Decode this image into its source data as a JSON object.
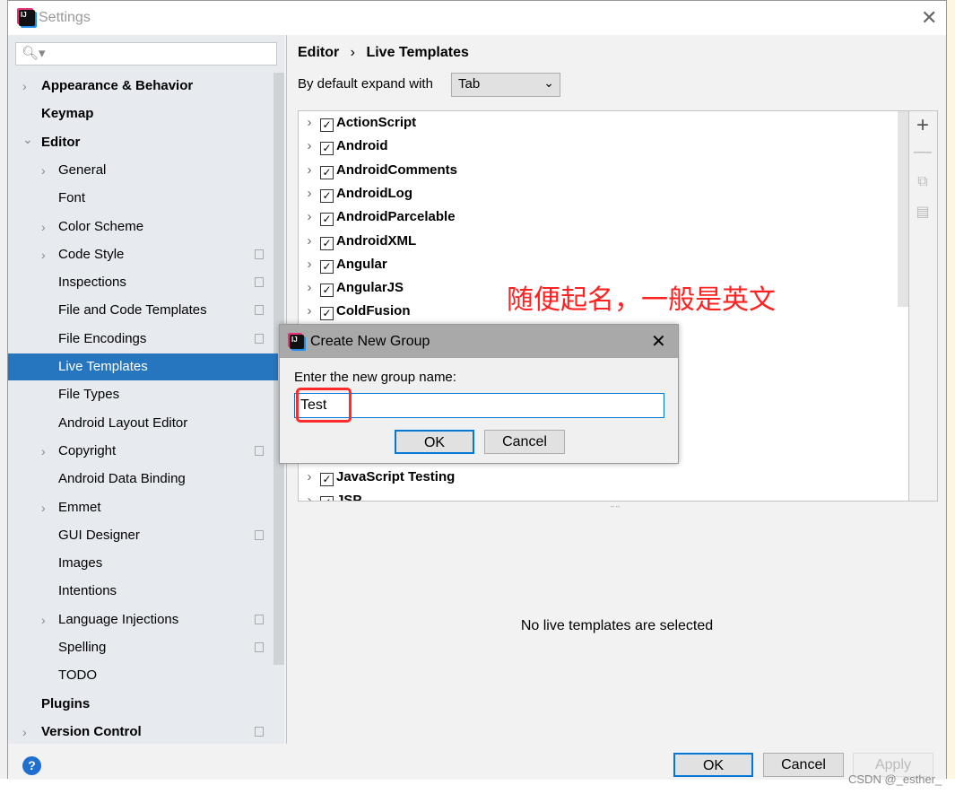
{
  "window": {
    "title": "Settings",
    "close_icon": "close-icon"
  },
  "sidebar": {
    "search_placeholder": "",
    "items": [
      {
        "label": "Appearance & Behavior",
        "level": 0,
        "bold": true,
        "expandable": true
      },
      {
        "label": "Keymap",
        "level": 0,
        "bold": true
      },
      {
        "label": "Editor",
        "level": 0,
        "bold": true,
        "expanded": true
      },
      {
        "label": "General",
        "level": 1,
        "expandable": true
      },
      {
        "label": "Font",
        "level": 1
      },
      {
        "label": "Color Scheme",
        "level": 1,
        "expandable": true
      },
      {
        "label": "Code Style",
        "level": 1,
        "expandable": true,
        "project": true
      },
      {
        "label": "Inspections",
        "level": 1,
        "project": true
      },
      {
        "label": "File and Code Templates",
        "level": 1,
        "project": true
      },
      {
        "label": "File Encodings",
        "level": 1,
        "project": true
      },
      {
        "label": "Live Templates",
        "level": 1,
        "selected": true
      },
      {
        "label": "File Types",
        "level": 1
      },
      {
        "label": "Android Layout Editor",
        "level": 1
      },
      {
        "label": "Copyright",
        "level": 1,
        "expandable": true,
        "project": true
      },
      {
        "label": "Android Data Binding",
        "level": 1
      },
      {
        "label": "Emmet",
        "level": 1,
        "expandable": true
      },
      {
        "label": "GUI Designer",
        "level": 1,
        "project": true
      },
      {
        "label": "Images",
        "level": 1
      },
      {
        "label": "Intentions",
        "level": 1
      },
      {
        "label": "Language Injections",
        "level": 1,
        "expandable": true,
        "project": true
      },
      {
        "label": "Spelling",
        "level": 1,
        "project": true
      },
      {
        "label": "TODO",
        "level": 1
      },
      {
        "label": "Plugins",
        "level": 0,
        "bold": true
      },
      {
        "label": "Version Control",
        "level": 0,
        "bold": true,
        "expandable": true,
        "project": true
      }
    ]
  },
  "main": {
    "breadcrumb": [
      "Editor",
      "Live Templates"
    ],
    "breadcrumb_sep": "›",
    "expand_label": "By default expand with",
    "expand_value": "Tab",
    "template_groups": [
      "ActionScript",
      "Android",
      "AndroidComments",
      "AndroidLog",
      "AndroidParcelable",
      "AndroidXML",
      "Angular",
      "AngularJS",
      "ColdFusion",
      "",
      "",
      "",
      "",
      "",
      "",
      "JavaScript Testing",
      "JSP"
    ],
    "empty_message": "No live templates are selected",
    "tools": [
      "add-icon",
      "remove-icon",
      "copy-icon",
      "restore-icon"
    ]
  },
  "dialog": {
    "title": "Create New Group",
    "prompt": "Enter the new group name:",
    "value": "Test",
    "ok": "OK",
    "cancel": "Cancel"
  },
  "footer": {
    "help": "?",
    "ok": "OK",
    "cancel": "Cancel",
    "apply": "Apply"
  },
  "annotation": "随便起名，一般是英文",
  "watermark": "CSDN @_esther_",
  "colors": {
    "selection": "#2675bf",
    "annotation": "#ff2020",
    "focus": "#0078d7"
  }
}
